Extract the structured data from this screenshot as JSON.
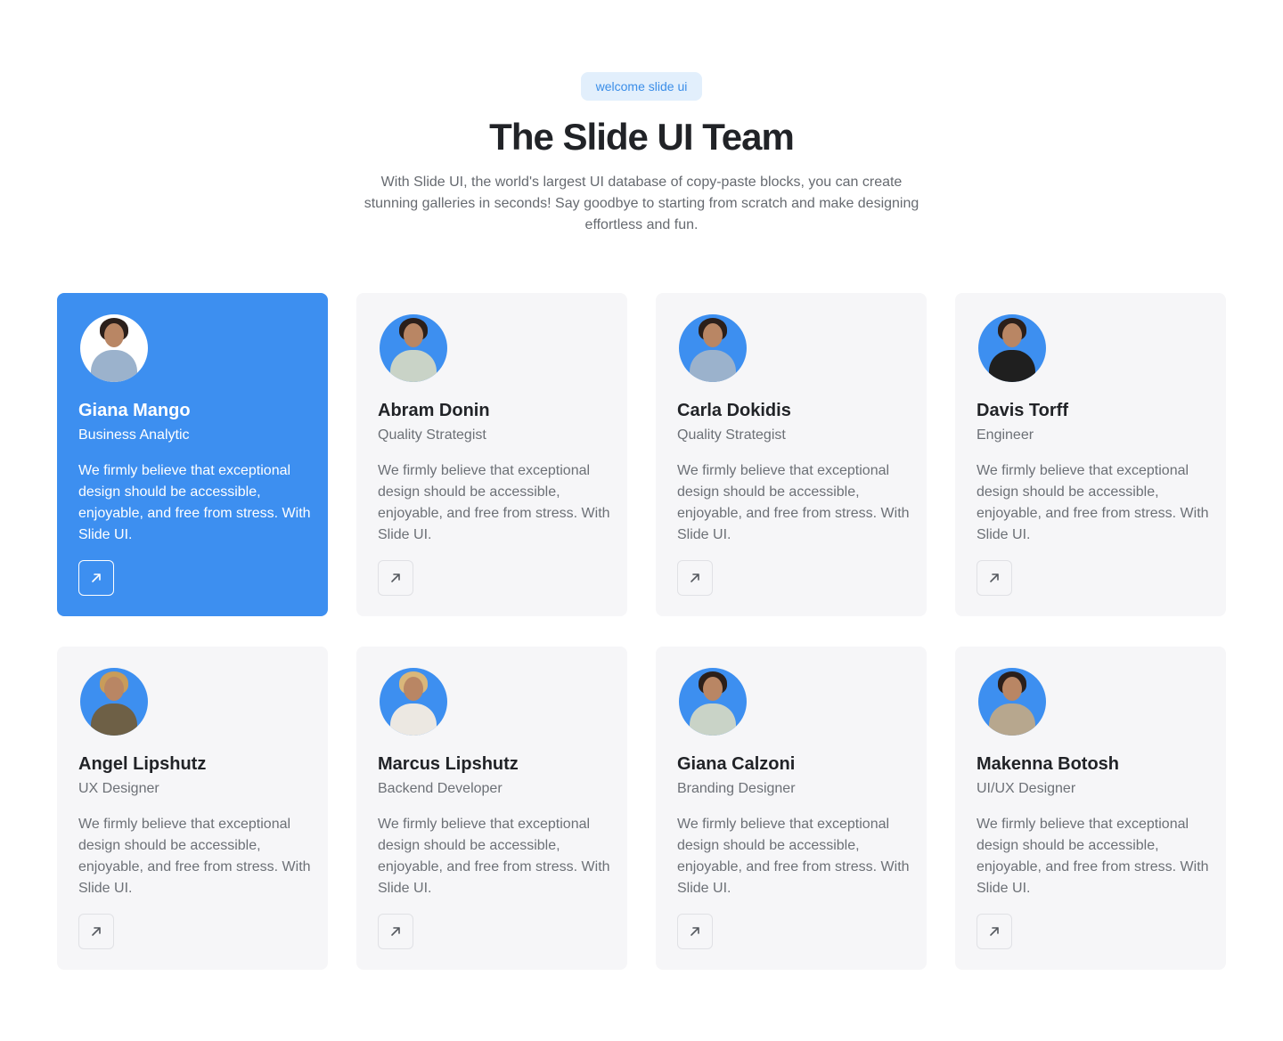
{
  "header": {
    "badge": "welcome slide ui",
    "title": "The Slide UI Team",
    "subtitle": "With Slide UI, the world's largest UI database of copy-paste blocks, you can create stunning galleries in seconds! Say goodbye to starting from scratch and make designing effortless and fun."
  },
  "accent_color": "#3d8ff0",
  "team": [
    {
      "name": "Giana Mango",
      "role": "Business Analytic",
      "description": "We firmly believe that exceptional design should be accessible, enjoyable, and free from stress. With Slide UI.",
      "icon": "arrow-up-right-icon"
    },
    {
      "name": "Abram Donin",
      "role": "Quality Strategist",
      "description": "We firmly believe that exceptional design should be accessible, enjoyable, and free from stress. With Slide UI.",
      "icon": "arrow-up-right-icon"
    },
    {
      "name": "Carla Dokidis",
      "role": "Quality Strategist",
      "description": "We firmly believe that exceptional design should be accessible, enjoyable, and free from stress. With Slide UI.",
      "icon": "arrow-up-right-icon"
    },
    {
      "name": "Davis Torff",
      "role": "Engineer",
      "description": "We firmly believe that exceptional design should be accessible, enjoyable, and free from stress. With Slide UI.",
      "icon": "arrow-up-right-icon"
    },
    {
      "name": "Angel Lipshutz",
      "role": "UX Designer",
      "description": "We firmly believe that exceptional design should be accessible, enjoyable, and free from stress. With Slide UI.",
      "icon": "arrow-up-right-icon"
    },
    {
      "name": "Marcus Lipshutz",
      "role": "Backend Developer",
      "description": "We firmly believe that exceptional design should be accessible, enjoyable, and free from stress. With Slide UI.",
      "icon": "arrow-up-right-icon"
    },
    {
      "name": "Giana Calzoni",
      "role": "Branding Designer",
      "description": "We firmly believe that exceptional design should be accessible, enjoyable, and free from stress. With Slide UI.",
      "icon": "arrow-up-right-icon"
    },
    {
      "name": "Makenna Botosh",
      "role": "UI/UX Designer",
      "description": "We firmly believe that exceptional design should be accessible, enjoyable, and free from stress. With Slide UI.",
      "icon": "arrow-up-right-icon"
    }
  ]
}
